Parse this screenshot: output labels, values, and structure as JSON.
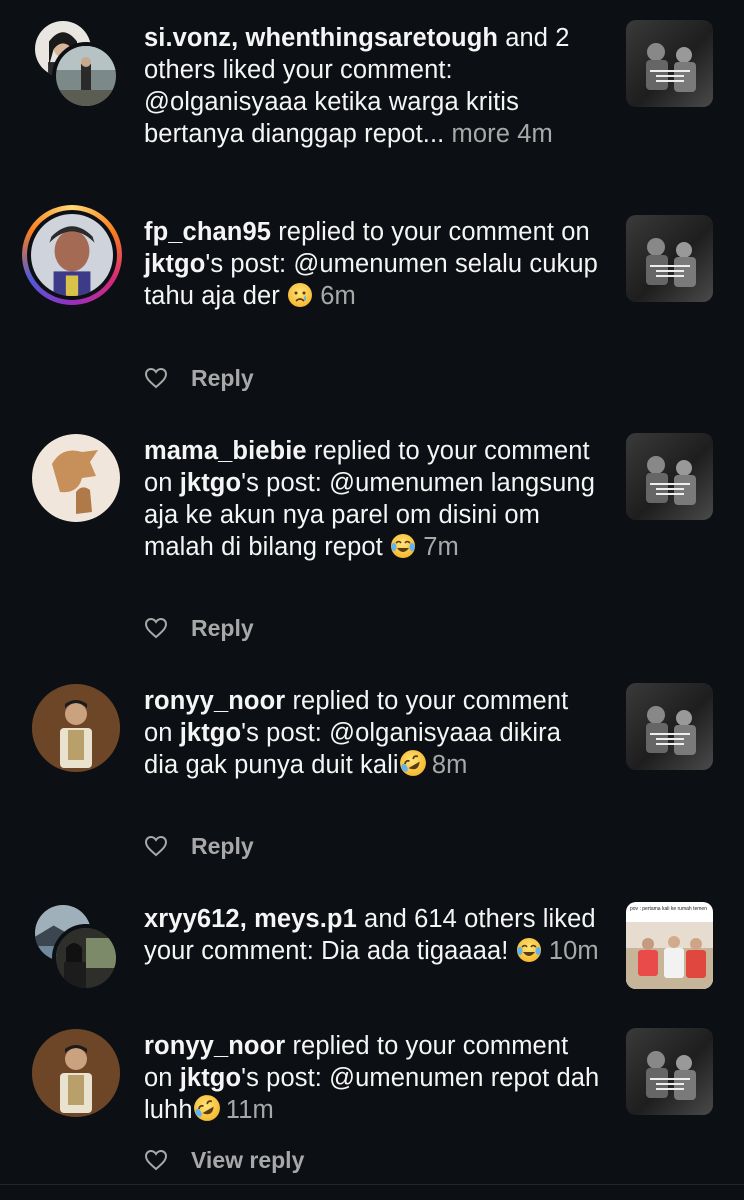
{
  "notifications": [
    {
      "users": "si.vonz, whenthingsaretough",
      "rest": " and 2 others liked your comment: @olganisyaaa ketika warga kritis bertanya dianggap repot...",
      "more": " more",
      "time": " 4m"
    },
    {
      "user": "fp_chan95",
      "mid": " replied to your comment on ",
      "post_owner": "jktgo",
      "after": "'s post: @umenumen selalu cukup tahu aja der ",
      "emoji": "crying-face-emoji",
      "time": " 6m",
      "action": "Reply"
    },
    {
      "user": "mama_biebie",
      "mid": " replied to your comment on ",
      "post_owner": "jktgo",
      "after": "'s post: @umenumen langsung aja ke akun nya parel om disini om malah di bilang repot ",
      "emoji": "tears-of-joy-emoji",
      "time": " 7m",
      "action": "Reply"
    },
    {
      "user": "ronyy_noor",
      "mid": " replied to your comment on ",
      "post_owner": "jktgo",
      "after": "'s post: @olganisyaaa dikira dia gak punya duit kali",
      "emoji": "rolling-laughing-emoji",
      "time": "  8m",
      "action": "Reply"
    },
    {
      "users": "xryy612, meys.p1",
      "rest": " and 614 others liked your comment: Dia ada tigaaaa! ",
      "emoji": "tears-of-joy-emoji",
      "time": " 10m",
      "thumb_caption": "pov : pertama kali ke rumah temen"
    },
    {
      "user": "ronyy_noor",
      "mid": " replied to your comment on ",
      "post_owner": "jktgo",
      "after": "'s post: @umenumen repot dah luhh",
      "emoji": "rolling-laughing-emoji",
      "time": " 11m",
      "action": "View reply"
    }
  ],
  "colors": {
    "background": "#0c1014",
    "text": "#f5f5f5",
    "secondary": "#a8a8a8",
    "story_ring": [
      "#feda75",
      "#fa7e1e",
      "#d62976",
      "#962fbf",
      "#4f5bd5"
    ]
  }
}
